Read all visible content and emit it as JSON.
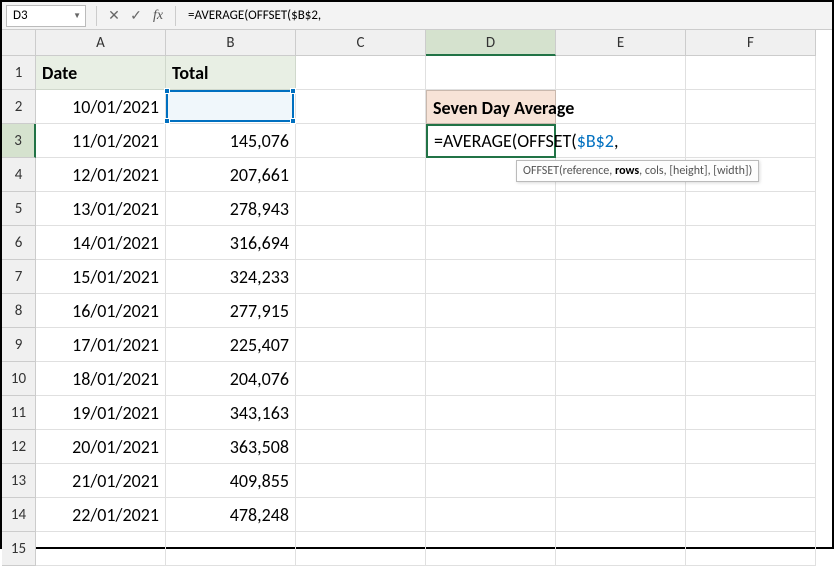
{
  "nameBox": "D3",
  "formula": "=AVERAGE(OFFSET($B$2,",
  "columns": [
    "A",
    "B",
    "C",
    "D",
    "E",
    "F"
  ],
  "headers": {
    "A": "Date",
    "B": "Total"
  },
  "titleCell": "Seven Day Average",
  "rows": [
    {
      "n": 1
    },
    {
      "n": 2,
      "date": "10/01/2021",
      "total": ""
    },
    {
      "n": 3,
      "date": "11/01/2021",
      "total": "145,076"
    },
    {
      "n": 4,
      "date": "12/01/2021",
      "total": "207,661"
    },
    {
      "n": 5,
      "date": "13/01/2021",
      "total": "278,943"
    },
    {
      "n": 6,
      "date": "14/01/2021",
      "total": "316,694"
    },
    {
      "n": 7,
      "date": "15/01/2021",
      "total": "324,233"
    },
    {
      "n": 8,
      "date": "16/01/2021",
      "total": "277,915"
    },
    {
      "n": 9,
      "date": "17/01/2021",
      "total": "225,407"
    },
    {
      "n": 10,
      "date": "18/01/2021",
      "total": "204,076"
    },
    {
      "n": 11,
      "date": "19/01/2021",
      "total": "343,163"
    },
    {
      "n": 12,
      "date": "20/01/2021",
      "total": "363,508"
    },
    {
      "n": 13,
      "date": "21/01/2021",
      "total": "409,855"
    },
    {
      "n": 14,
      "date": "22/01/2021",
      "total": "478,248"
    },
    {
      "n": 15
    }
  ],
  "editFormula": {
    "pre": "=AVERAGE(OFFSET(",
    "ref": "$B$2",
    "post": ","
  },
  "tooltip": {
    "fn": "OFFSET(",
    "a1": "reference",
    "bold": "rows",
    "rest": ", cols, [height], [width])"
  }
}
